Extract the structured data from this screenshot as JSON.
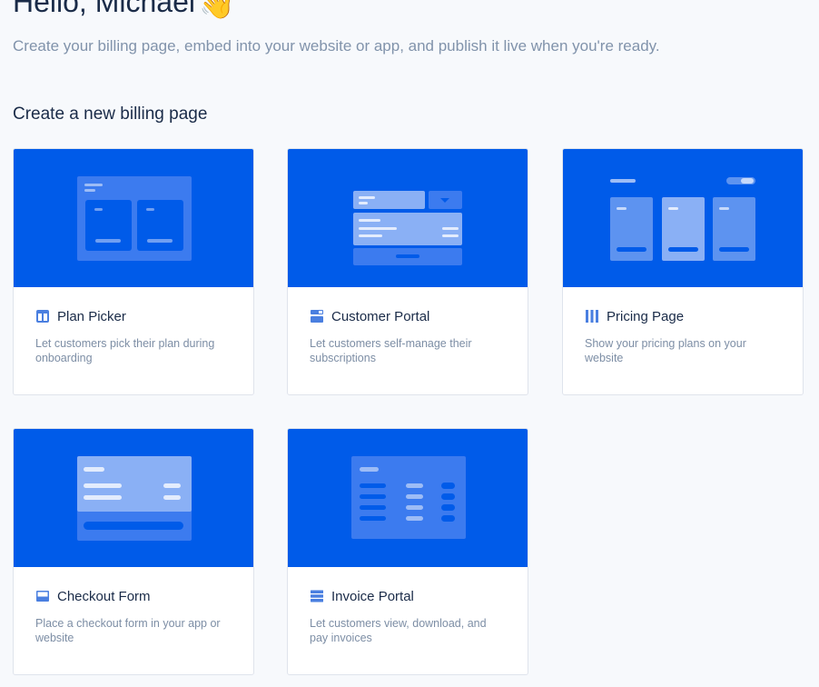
{
  "header": {
    "greeting": "Hello, Michael",
    "greeting_emoji": "👋",
    "subtitle": "Create your billing page, embed into your website or app, and publish it live when you're ready."
  },
  "section": {
    "title": "Create a new billing page"
  },
  "cards": [
    {
      "title": "Plan Picker",
      "description": "Let customers pick their plan during onboarding",
      "icon": "columns-icon"
    },
    {
      "title": "Customer Portal",
      "description": "Let customers self-manage their subscriptions",
      "icon": "layout-icon"
    },
    {
      "title": "Pricing Page",
      "description": "Show your pricing plans on your website",
      "icon": "pricing-columns-icon"
    },
    {
      "title": "Checkout Form",
      "description": "Place a checkout form in your app or website",
      "icon": "window-icon"
    },
    {
      "title": "Invoice Portal",
      "description": "Let customers view, download, and pay invoices",
      "icon": "list-icon"
    }
  ],
  "colors": {
    "accent": "#005be9",
    "page_background": "#f7f9fc",
    "icon": "#4a7fe0"
  }
}
